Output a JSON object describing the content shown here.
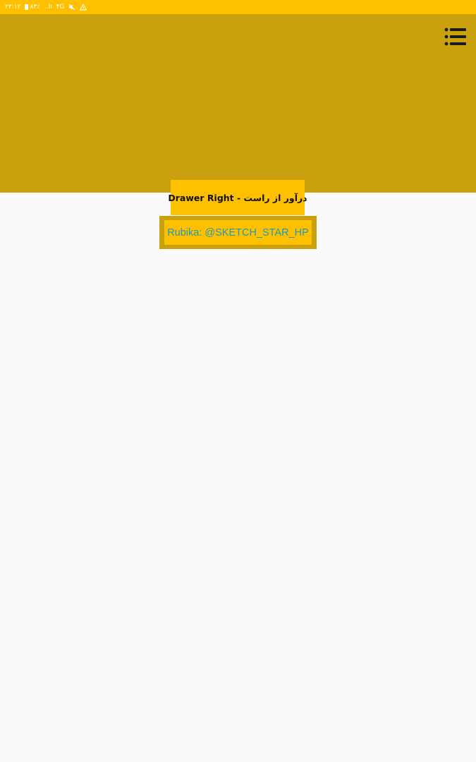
{
  "status_bar": {
    "time": "۲۲:۱۲",
    "battery": "۸۳٪",
    "signal": "..lı",
    "network": "۴G",
    "mute_icon": "mute-icon",
    "warning_icon": "warning-icon"
  },
  "header": {
    "menu_icon": "list-menu-icon",
    "title": "Drawer Right - درآور از راست"
  },
  "link": {
    "label": "Rubika: @SKETCH_STAR_HP"
  },
  "colors": {
    "status_bar": "#ffc000",
    "header": "#c9a10f",
    "title_box": "#ffc000",
    "link_text": "#1e9bb3",
    "background": "#fafafa"
  }
}
